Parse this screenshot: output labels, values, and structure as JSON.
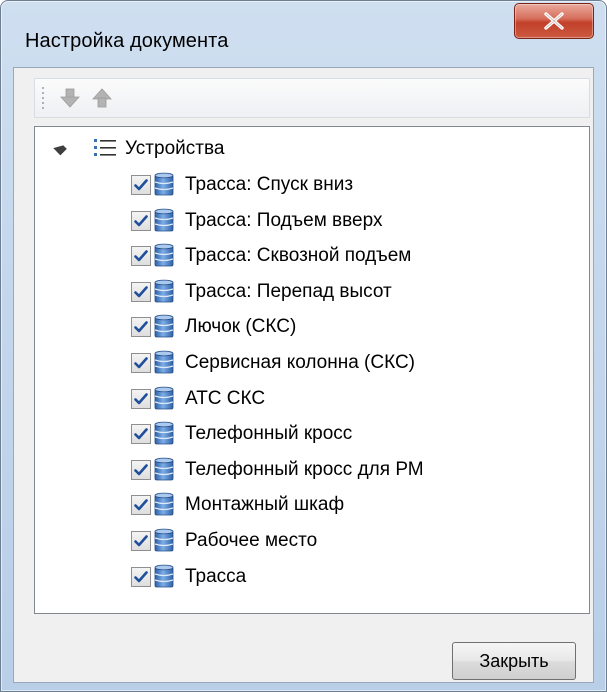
{
  "window": {
    "title": "Настройка документа",
    "close_icon": "close-x-icon"
  },
  "toolbar": {
    "move_down_icon": "arrow-down-icon",
    "move_up_icon": "arrow-up-icon"
  },
  "tree": {
    "root": {
      "label": "Устройства",
      "expanded": true,
      "icon": "list-icon"
    },
    "items": [
      {
        "label": "Трасса: Спуск вниз",
        "checked": true,
        "icon": "database-icon"
      },
      {
        "label": "Трасса: Подъем вверх",
        "checked": true,
        "icon": "database-icon"
      },
      {
        "label": "Трасса: Сквозной подъем",
        "checked": true,
        "icon": "database-icon"
      },
      {
        "label": "Трасса: Перепад высот",
        "checked": true,
        "icon": "database-icon"
      },
      {
        "label": "Лючок (СКС)",
        "checked": true,
        "icon": "database-icon"
      },
      {
        "label": "Сервисная колонна (СКС)",
        "checked": true,
        "icon": "database-icon"
      },
      {
        "label": "АТС СКС",
        "checked": true,
        "icon": "database-icon"
      },
      {
        "label": "Телефонный кросс",
        "checked": true,
        "icon": "database-icon"
      },
      {
        "label": "Телефонный кросс для РМ",
        "checked": true,
        "icon": "database-icon"
      },
      {
        "label": "Монтажный шкаф",
        "checked": true,
        "icon": "database-icon"
      },
      {
        "label": "Рабочее место",
        "checked": true,
        "icon": "database-icon"
      },
      {
        "label": "Трасса",
        "checked": true,
        "icon": "database-icon"
      }
    ]
  },
  "footer": {
    "close_label": "Закрыть"
  },
  "colors": {
    "title_bar": "#c3d6ec",
    "close_button": "#c2402a",
    "client_bg": "#f0f0f0",
    "check_mark": "#1f4e9a",
    "db_icon": "#4a7fc7"
  }
}
